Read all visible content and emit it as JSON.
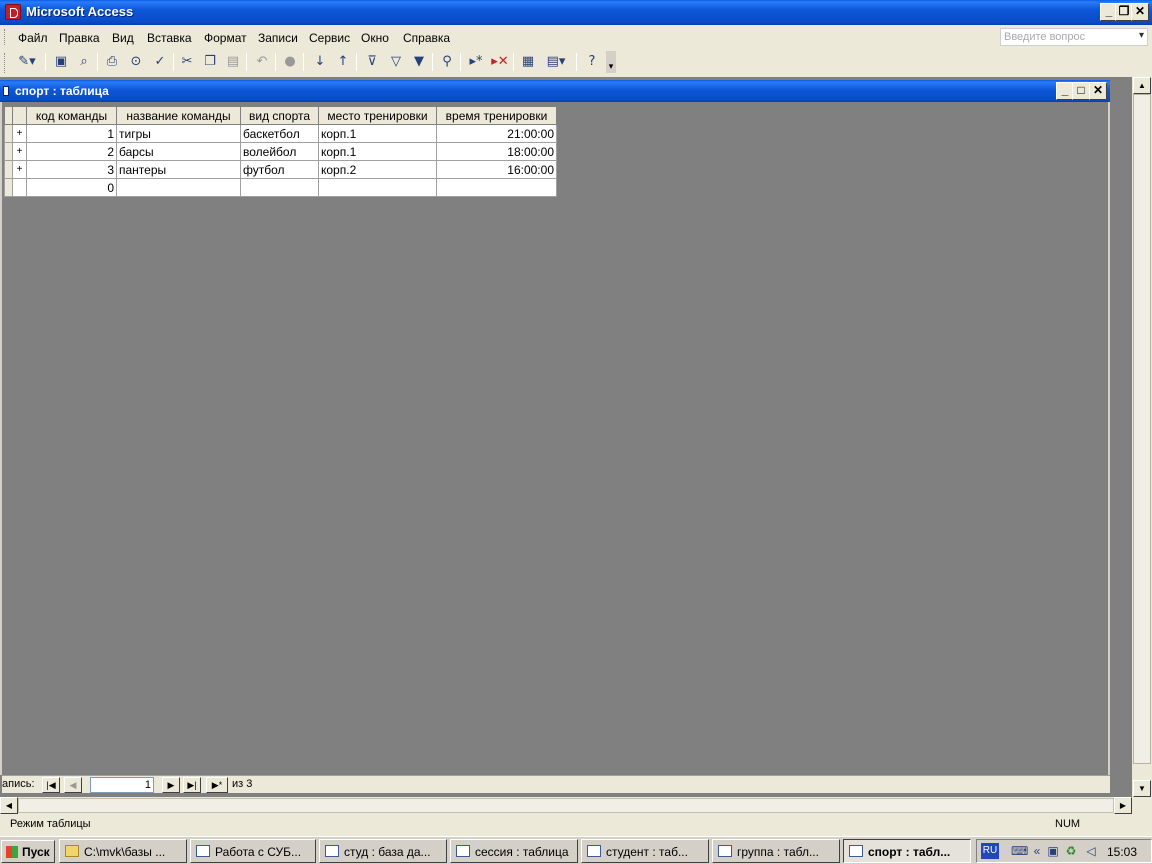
{
  "window": {
    "title": "Microsoft Access"
  },
  "menu": {
    "items": [
      "Файл",
      "Правка",
      "Вид",
      "Вставка",
      "Формат",
      "Записи",
      "Сервис",
      "Окно",
      "Справка"
    ],
    "help_placeholder": "Введите вопрос"
  },
  "toolbar": {
    "icons": [
      "view-design-icon",
      "save-icon",
      "search-file-icon",
      "print-icon",
      "print-preview-icon",
      "spelling-icon",
      "cut-icon",
      "copy-icon",
      "paste-icon",
      "undo-icon",
      "hyperlink-icon",
      "sort-ascending-icon",
      "sort-descending-icon",
      "filter-by-selection-icon",
      "filter-by-form-icon",
      "apply-filter-icon",
      "find-icon",
      "new-record-icon",
      "delete-record-icon",
      "database-window-icon",
      "new-object-icon",
      "help-icon"
    ]
  },
  "child": {
    "title": "спорт : таблица"
  },
  "table": {
    "columns": [
      "код команды",
      "название команды",
      "вид спорта",
      "место тренировки",
      "время тренировки"
    ],
    "rows": [
      {
        "id": "1",
        "name": "тигры",
        "sport": "баскетбол",
        "place": "корп.1",
        "time": "21:00:00"
      },
      {
        "id": "2",
        "name": "барсы",
        "sport": "волейбол",
        "place": "корп.1",
        "time": "18:00:00"
      },
      {
        "id": "3",
        "name": "пантеры",
        "sport": "футбол",
        "place": "корп.2",
        "time": "16:00:00"
      }
    ],
    "new_row_id": "0"
  },
  "record_nav": {
    "label": "апись:",
    "current": "1",
    "of_text": "из  3"
  },
  "status": {
    "mode": "Режим таблицы",
    "num": "NUM"
  },
  "taskbar": {
    "start": "Пуск",
    "tasks": [
      "C:\\mvk\\базы ...",
      "Работа с СУБ...",
      "студ : база да...",
      "сессия : таблица",
      "студент : таб...",
      "группа : табл...",
      "спорт : табл..."
    ],
    "lang": "RU",
    "clock": "15:03"
  }
}
